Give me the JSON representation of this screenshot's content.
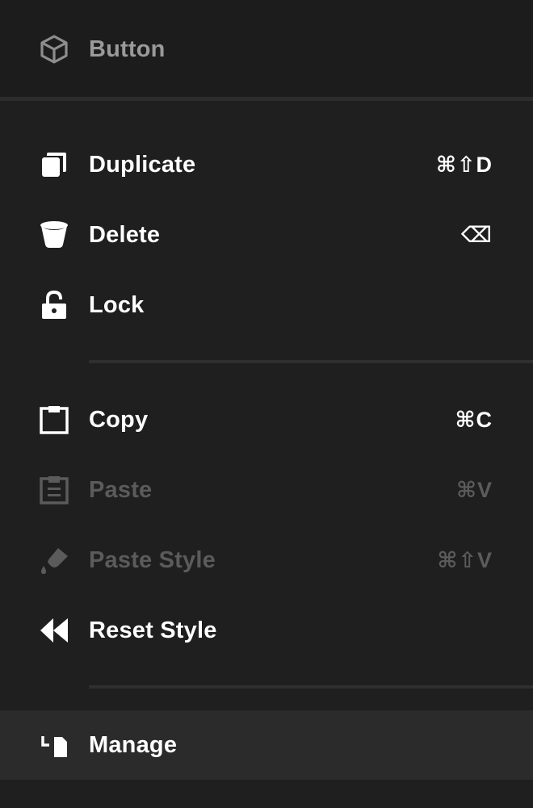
{
  "header": {
    "title": "Button",
    "icon": "cube-icon"
  },
  "sections": [
    {
      "items": [
        {
          "label": "Duplicate",
          "shortcut": "⌘⇧D",
          "icon": "duplicate-icon",
          "enabled": true
        },
        {
          "label": "Delete",
          "shortcut": "⌫",
          "icon": "trash-icon",
          "enabled": true
        },
        {
          "label": "Lock",
          "shortcut": "",
          "icon": "lock-icon",
          "enabled": true
        }
      ]
    },
    {
      "items": [
        {
          "label": "Copy",
          "shortcut": "⌘C",
          "icon": "clipboard-icon",
          "enabled": true
        },
        {
          "label": "Paste",
          "shortcut": "⌘V",
          "icon": "paste-icon",
          "enabled": false
        },
        {
          "label": "Paste Style",
          "shortcut": "⌘⇧V",
          "icon": "paint-bucket-icon",
          "enabled": false
        },
        {
          "label": "Reset Style",
          "shortcut": "",
          "icon": "rewind-icon",
          "enabled": true
        }
      ]
    },
    {
      "items": [
        {
          "label": "Manage",
          "shortcut": "",
          "icon": "manage-icon",
          "enabled": true,
          "highlighted": true
        }
      ]
    }
  ],
  "colors": {
    "background": "#1f1f1f",
    "text": "#ffffff",
    "disabled_text": "#5b5b5b",
    "header_text": "#9a9a9a",
    "highlight": "#2b2b2b"
  }
}
